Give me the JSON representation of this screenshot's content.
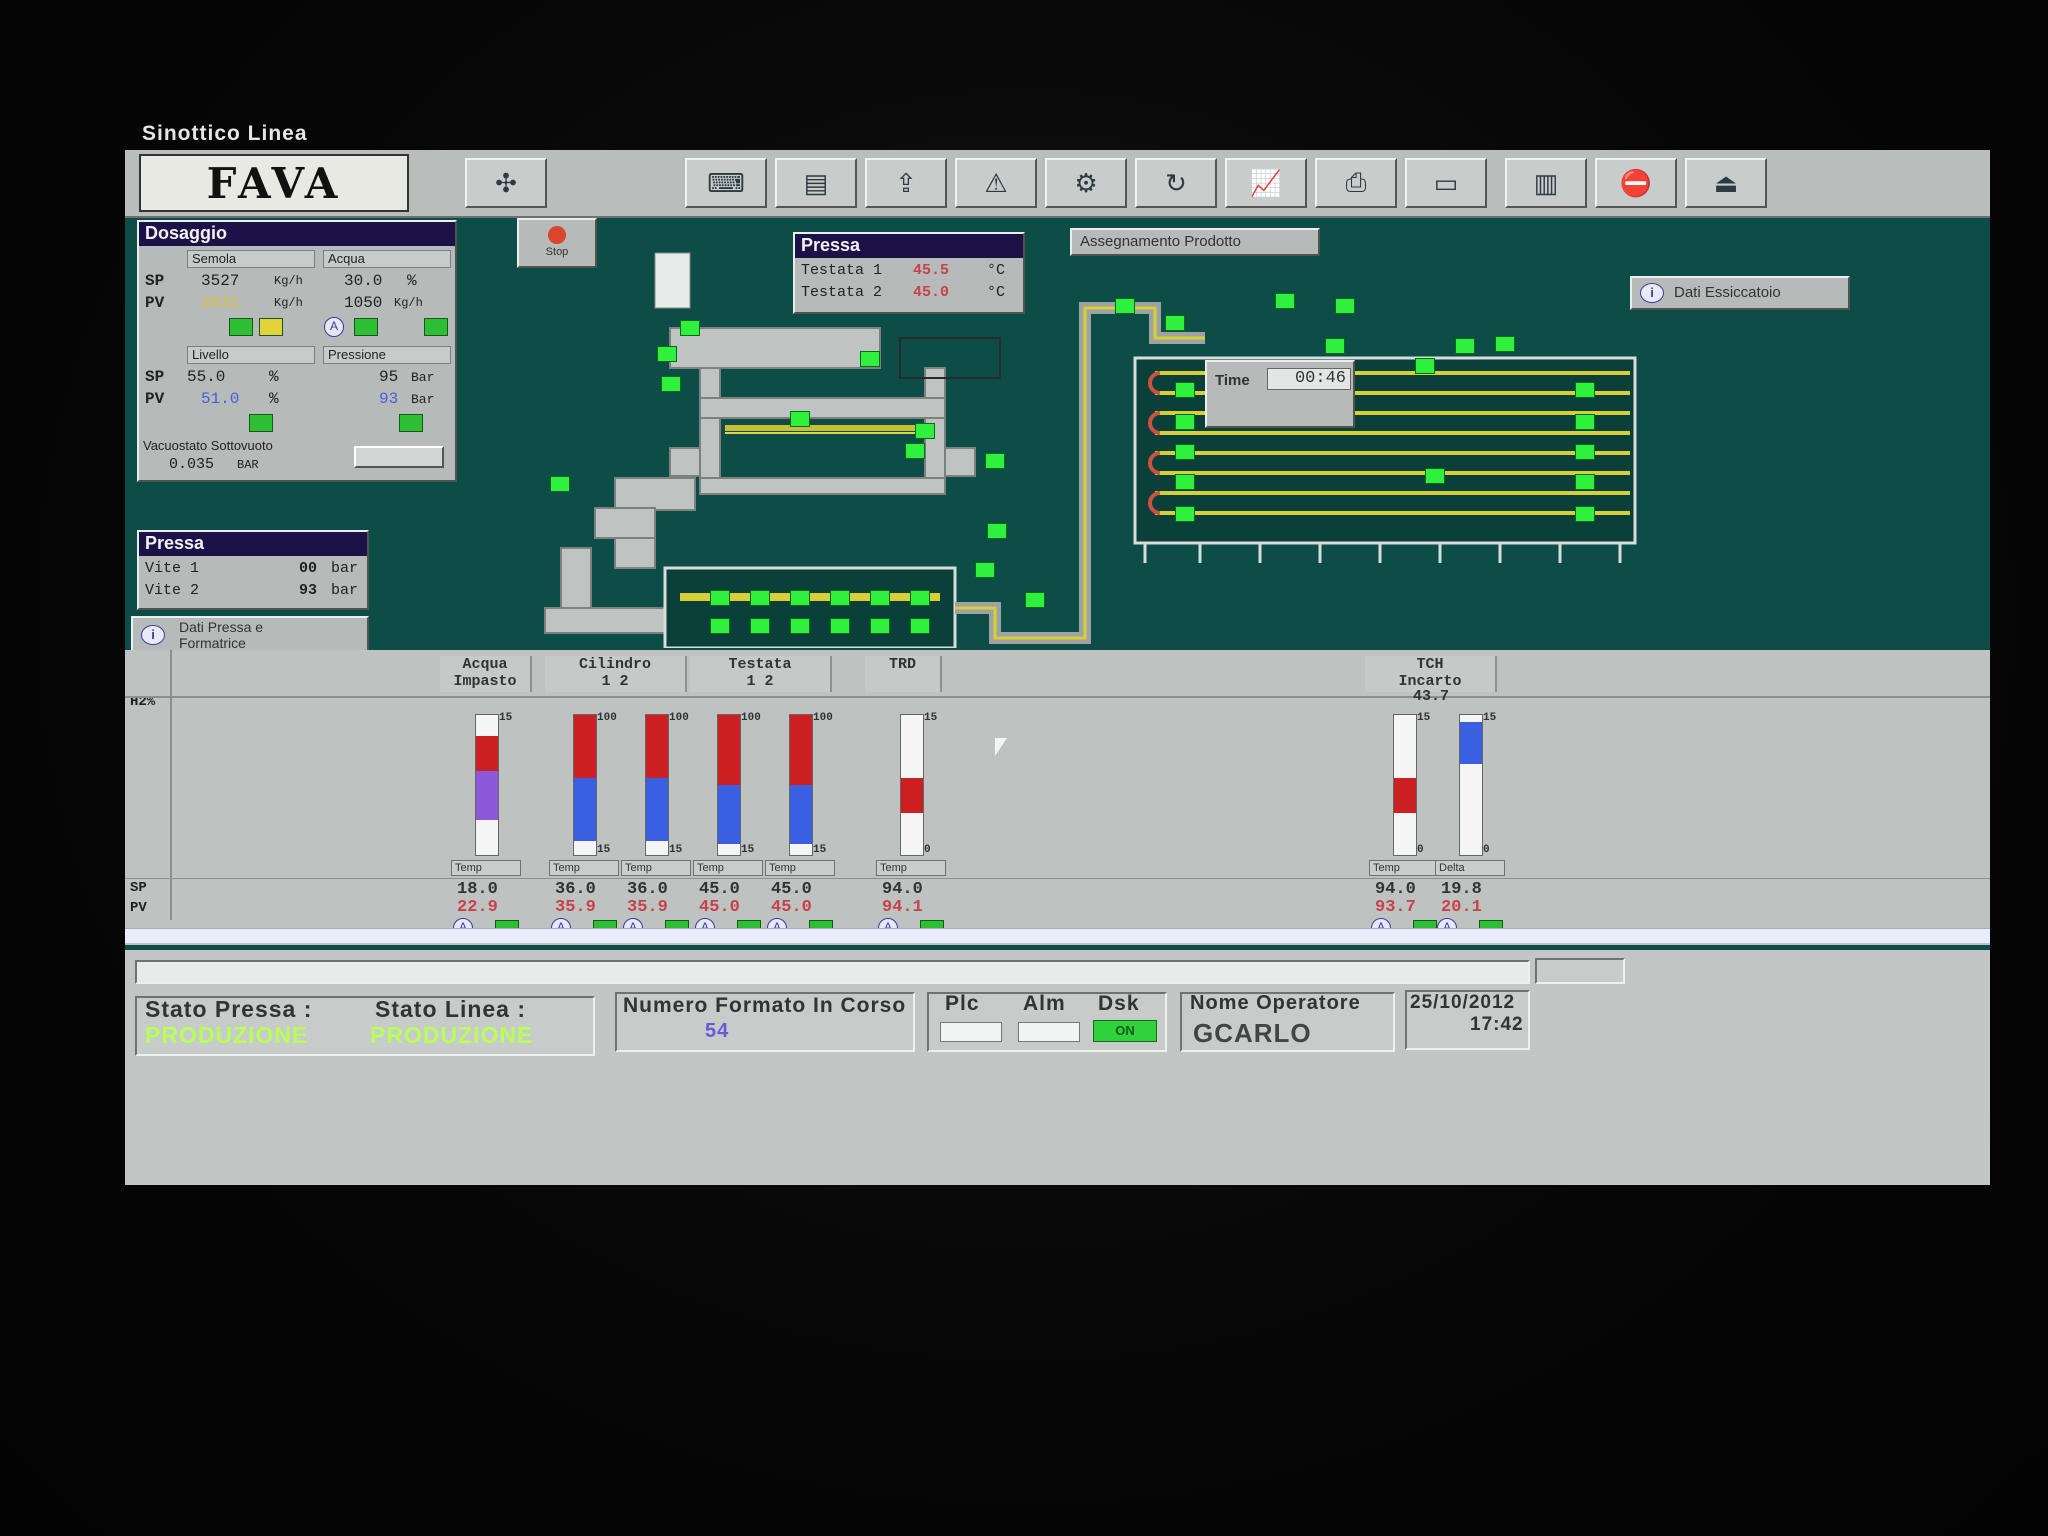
{
  "window": {
    "title": "Sinottico Linea"
  },
  "toolbar": {
    "logo": "FAVA",
    "buttons": [
      {
        "name": "layout-map-icon",
        "glyph": "✣"
      },
      {
        "name": "operator-station-icon",
        "glyph": "⌨"
      },
      {
        "name": "report-icon",
        "glyph": "▤"
      },
      {
        "name": "export-icon",
        "glyph": "⇪"
      },
      {
        "name": "alarm-icon",
        "glyph": "⚠"
      },
      {
        "name": "machine-icon",
        "glyph": "⚙"
      },
      {
        "name": "refresh-icon",
        "glyph": "↻"
      },
      {
        "name": "trend-icon",
        "glyph": "📈"
      },
      {
        "name": "printer-icon",
        "glyph": "⎙"
      },
      {
        "name": "folder-icon",
        "glyph": "▭"
      },
      {
        "name": "chart-icon",
        "glyph": "▥"
      },
      {
        "name": "no-entry-icon",
        "glyph": "⛔"
      },
      {
        "name": "exit-icon",
        "glyph": "⏏"
      }
    ]
  },
  "dosaggio": {
    "title": "Dosaggio",
    "col1_select": "Semola",
    "col2_select": "Acqua",
    "sp_label": "SP",
    "pv_label": "PV",
    "sp1": "3527",
    "sp1_unit": "Kg/h",
    "pv1": "3531",
    "pv1_unit": "Kg/h",
    "sp2": "30.0",
    "sp2_unit": "%",
    "pv2": "1050",
    "pv2_unit": "Kg/h",
    "col3_select": "Livello",
    "col4_select": "Pressione",
    "sp3": "55.0",
    "sp3_unit": "%",
    "pv3": "51.0",
    "pv3_unit": "%",
    "sp4": "95",
    "sp4_unit": "Bar",
    "pv4": "93",
    "pv4_unit": "Bar",
    "vacuum_label": "Vacuostato Sottovuoto",
    "vacuum_value": "0.035",
    "vacuum_unit": "BAR"
  },
  "alarm_button_label": "Stop",
  "pressa_top": {
    "title": "Pressa",
    "rows": [
      {
        "label": "Testata 1",
        "value": "45.5",
        "unit": "°C"
      },
      {
        "label": "Testata 2",
        "value": "45.0",
        "unit": "°C"
      }
    ]
  },
  "assignment_button": "Assegnamento Prodotto",
  "dryer_info_button": "Dati Essiccatoio",
  "timer": {
    "label": "Time",
    "value": "00:46"
  },
  "pressa_left": {
    "title": "Pressa",
    "rows": [
      {
        "label": "Vite 1",
        "value": "00",
        "unit": "bar"
      },
      {
        "label": "Vite 2",
        "value": "93",
        "unit": "bar"
      }
    ]
  },
  "press_info_button": "Dati Pressa e Formatrice",
  "grid": {
    "row_h2o": "H2%",
    "row_sp": "SP",
    "row_pv": "PV",
    "headers": [
      {
        "line1": "Acqua",
        "line2": "Impasto"
      },
      {
        "line1": "Cilindro",
        "line2": "1    2"
      },
      {
        "line1": "Testata",
        "line2": "1    2"
      },
      {
        "line1": "TRD",
        "line2": ""
      },
      {
        "line1": "TCH",
        "line2": "Incarto"
      }
    ],
    "tch_top_value": "43.7",
    "gauges": [
      {
        "sel": "Temp",
        "sp": "18.0",
        "pv": "22.9",
        "top": "15",
        "bottom": "",
        "fill_top": 0.15,
        "fill_red": 0.25,
        "fill_blue": 0.35
      },
      {
        "sel": "Temp",
        "sp": "36.0",
        "pv": "35.9",
        "top": "100",
        "bottom": "15",
        "fill_top": 0.0,
        "fill_red": 0.45,
        "fill_blue": 0.45
      },
      {
        "sel": "Temp",
        "sp": "36.0",
        "pv": "35.9",
        "top": "100",
        "bottom": "15",
        "fill_top": 0.0,
        "fill_red": 0.45,
        "fill_blue": 0.45
      },
      {
        "sel": "Temp",
        "sp": "45.0",
        "pv": "45.0",
        "top": "100",
        "bottom": "15",
        "fill_top": 0.0,
        "fill_red": 0.5,
        "fill_blue": 0.42
      },
      {
        "sel": "Temp",
        "sp": "45.0",
        "pv": "45.0",
        "top": "100",
        "bottom": "15",
        "fill_top": 0.0,
        "fill_red": 0.5,
        "fill_blue": 0.42
      },
      {
        "sel": "Temp",
        "sp": "94.0",
        "pv": "94.1",
        "top": "15",
        "bottom": "0",
        "fill_top": 0.45,
        "fill_red": 0.25,
        "fill_blue": 0.0
      },
      {
        "sel": "Temp",
        "sp": "94.0",
        "pv": "93.7",
        "top": "15",
        "bottom": "0",
        "fill_top": 0.45,
        "fill_red": 0.25,
        "fill_blue": 0.0
      },
      {
        "sel": "Delta",
        "sp": "19.8",
        "pv": "20.1",
        "top": "15",
        "bottom": "0",
        "fill_top": 0.05,
        "fill_red": 0.0,
        "fill_blue": 0.3
      }
    ]
  },
  "status": {
    "stato_pressa_label": "Stato Pressa :",
    "stato_pressa_value": "PRODUZIONE",
    "stato_linea_label": "Stato Linea :",
    "stato_linea_value": "PRODUZIONE",
    "formato_label": "Numero Formato In Corso",
    "formato_value": "54",
    "plc_label": "Plc",
    "alm_label": "Alm",
    "dsk_label": "Dsk",
    "dsk_value": "ON",
    "operatore_label": "Nome Operatore",
    "operatore_value": "GCARLO",
    "date": "25/10/2012",
    "time": "17:42"
  },
  "colors": {
    "screen_bg": "#0d4d47",
    "panel_title": "#1d1248",
    "status_green": "#b8ff5a",
    "gauge_red": "#cc1f22",
    "gauge_blue": "#3a5fe0"
  }
}
